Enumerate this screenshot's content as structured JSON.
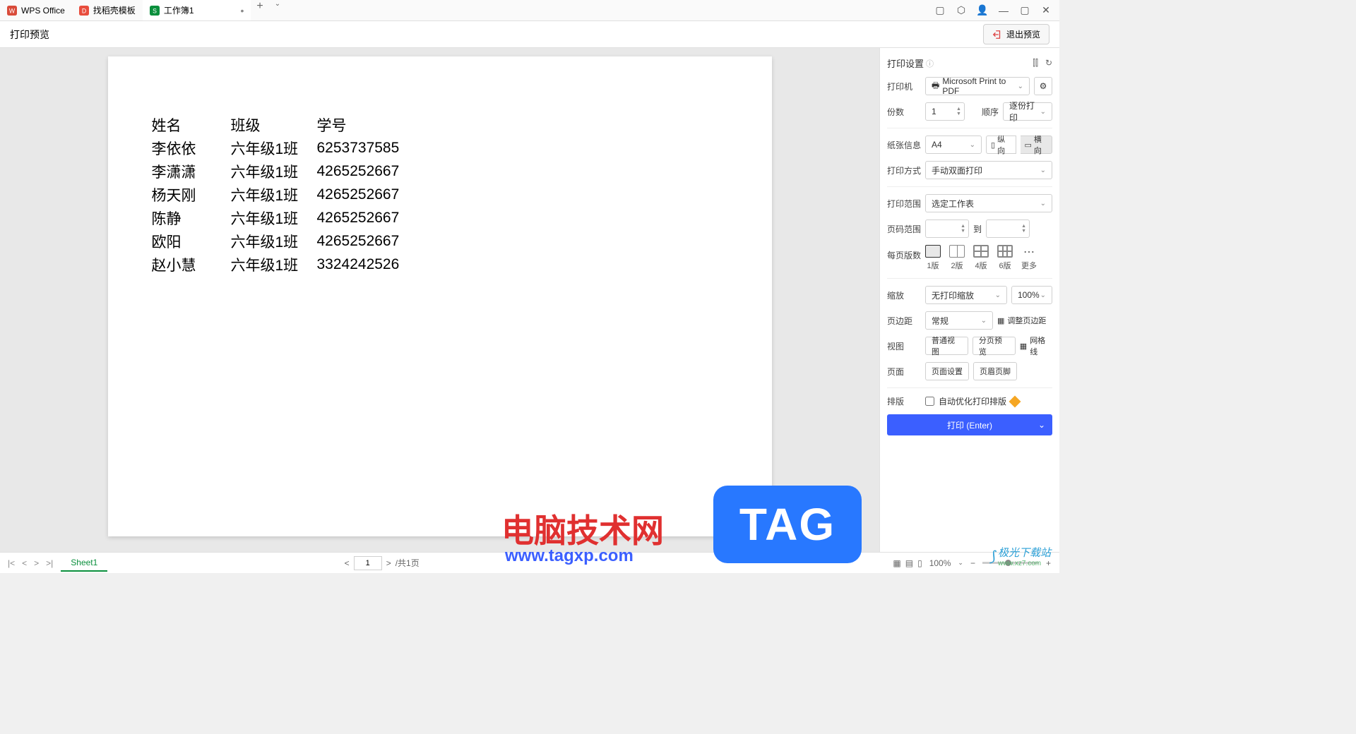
{
  "titlebar": {
    "tabs": [
      {
        "label": "WPS Office",
        "icon_color": "#d94b3a"
      },
      {
        "label": "找稻壳模板",
        "icon_color": "#e84d3d"
      },
      {
        "label": "工作簿1",
        "icon_color": "#0a8f3c",
        "active": true
      }
    ]
  },
  "toolbar": {
    "title": "打印预览",
    "exit_label": "退出预览"
  },
  "table": {
    "headers": [
      "姓名",
      "班级",
      "学号"
    ],
    "rows": [
      [
        "李依依",
        "六年级1班",
        "6253737585"
      ],
      [
        "李潇潇",
        "六年级1班",
        "4265252667"
      ],
      [
        "杨天刚",
        "六年级1班",
        "4265252667"
      ],
      [
        "陈静",
        "六年级1班",
        "4265252667"
      ],
      [
        "欧阳",
        "六年级1班",
        "4265252667"
      ],
      [
        "赵小慧",
        "六年级1班",
        "3324242526"
      ]
    ]
  },
  "settings": {
    "title": "打印设置",
    "printer_label": "打印机",
    "printer_value": "Microsoft Print to PDF",
    "copies_label": "份数",
    "copies_value": "1",
    "order_label": "顺序",
    "order_value": "逐份打印",
    "paper_label": "纸张信息",
    "paper_value": "A4",
    "portrait_label": "纵向",
    "landscape_label": "横向",
    "method_label": "打印方式",
    "method_value": "手动双面打印",
    "range_label": "打印范围",
    "range_value": "选定工作表",
    "page_range_label": "页码范围",
    "page_range_to": "到",
    "per_page_label": "每页版数",
    "layouts": [
      "1版",
      "2版",
      "4版",
      "6版",
      "更多"
    ],
    "zoom_label": "缩放",
    "zoom_mode": "无打印缩放",
    "zoom_value": "100%",
    "margin_label": "页边距",
    "margin_value": "常规",
    "margin_adjust": "调整页边距",
    "view_label": "视图",
    "view_normal": "普通视图",
    "view_paged": "分页预览",
    "view_grid": "网格线",
    "page_label": "页面",
    "page_setup": "页面设置",
    "page_header": "页眉页脚",
    "layout_label": "排版",
    "auto_optimize": "自动优化打印排版",
    "print_button": "打印 (Enter)"
  },
  "bottom": {
    "sheet_name": "Sheet1",
    "page_current": "1",
    "page_total": "/共1页",
    "zoom_pct": "100%"
  },
  "watermarks": {
    "w1": "电脑技术网",
    "w1_sub": "www.tagxp.com",
    "tag": "TAG",
    "w2": "极光下载站",
    "w2_sub": "www.xz7.com"
  }
}
